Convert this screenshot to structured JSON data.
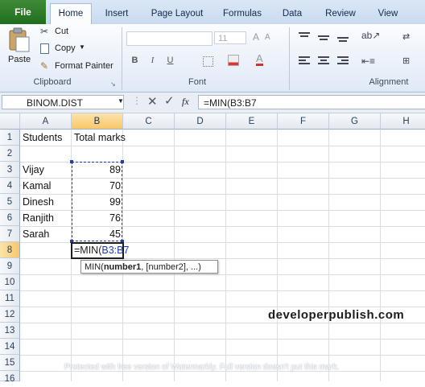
{
  "tabs": [
    "File",
    "Home",
    "Insert",
    "Page Layout",
    "Formulas",
    "Data",
    "Review",
    "View"
  ],
  "ribbon": {
    "clipboard": {
      "paste": "Paste",
      "cut": "Cut",
      "copy": "Copy",
      "format_painter": "Format Painter",
      "label": "Clipboard"
    },
    "font": {
      "size": "11",
      "bold": "B",
      "italic": "I",
      "underline": "U",
      "label": "Font"
    },
    "alignment": {
      "label": "Alignment"
    }
  },
  "formula_bar": {
    "name_box": "BINOM.DIST",
    "fx": "fx",
    "formula": "=MIN(B3:B7"
  },
  "columns": [
    "A",
    "B",
    "C",
    "D",
    "E",
    "F",
    "G",
    "H"
  ],
  "rows": [
    "1",
    "2",
    "3",
    "4",
    "5",
    "6",
    "7",
    "8",
    "9",
    "10",
    "11",
    "12",
    "13",
    "14",
    "15",
    "16"
  ],
  "sheet": {
    "A1": "Students",
    "B1": "Total marks",
    "A3": "Vijay",
    "B3": "89",
    "A4": "Kamal",
    "B4": "70",
    "A5": "Dinesh",
    "B5": "99",
    "A6": "Ranjith",
    "B6": "76",
    "A7": "Sarah",
    "B7": "45",
    "B8_prefix": "=MIN(",
    "B8_ref": "B3:B7"
  },
  "tooltip": {
    "fn": "MIN(",
    "arg1": "number1",
    "rest": ", [number2], ...)"
  },
  "watermark": {
    "site": "developerpublish.com",
    "notice": "Protected with free version of Watermarkly. Full version doesn't put this mark."
  },
  "colors": {
    "file_tab": "#2a7a27",
    "selection_header": "#f7c86a",
    "range_ref": "#1f3fb0"
  }
}
